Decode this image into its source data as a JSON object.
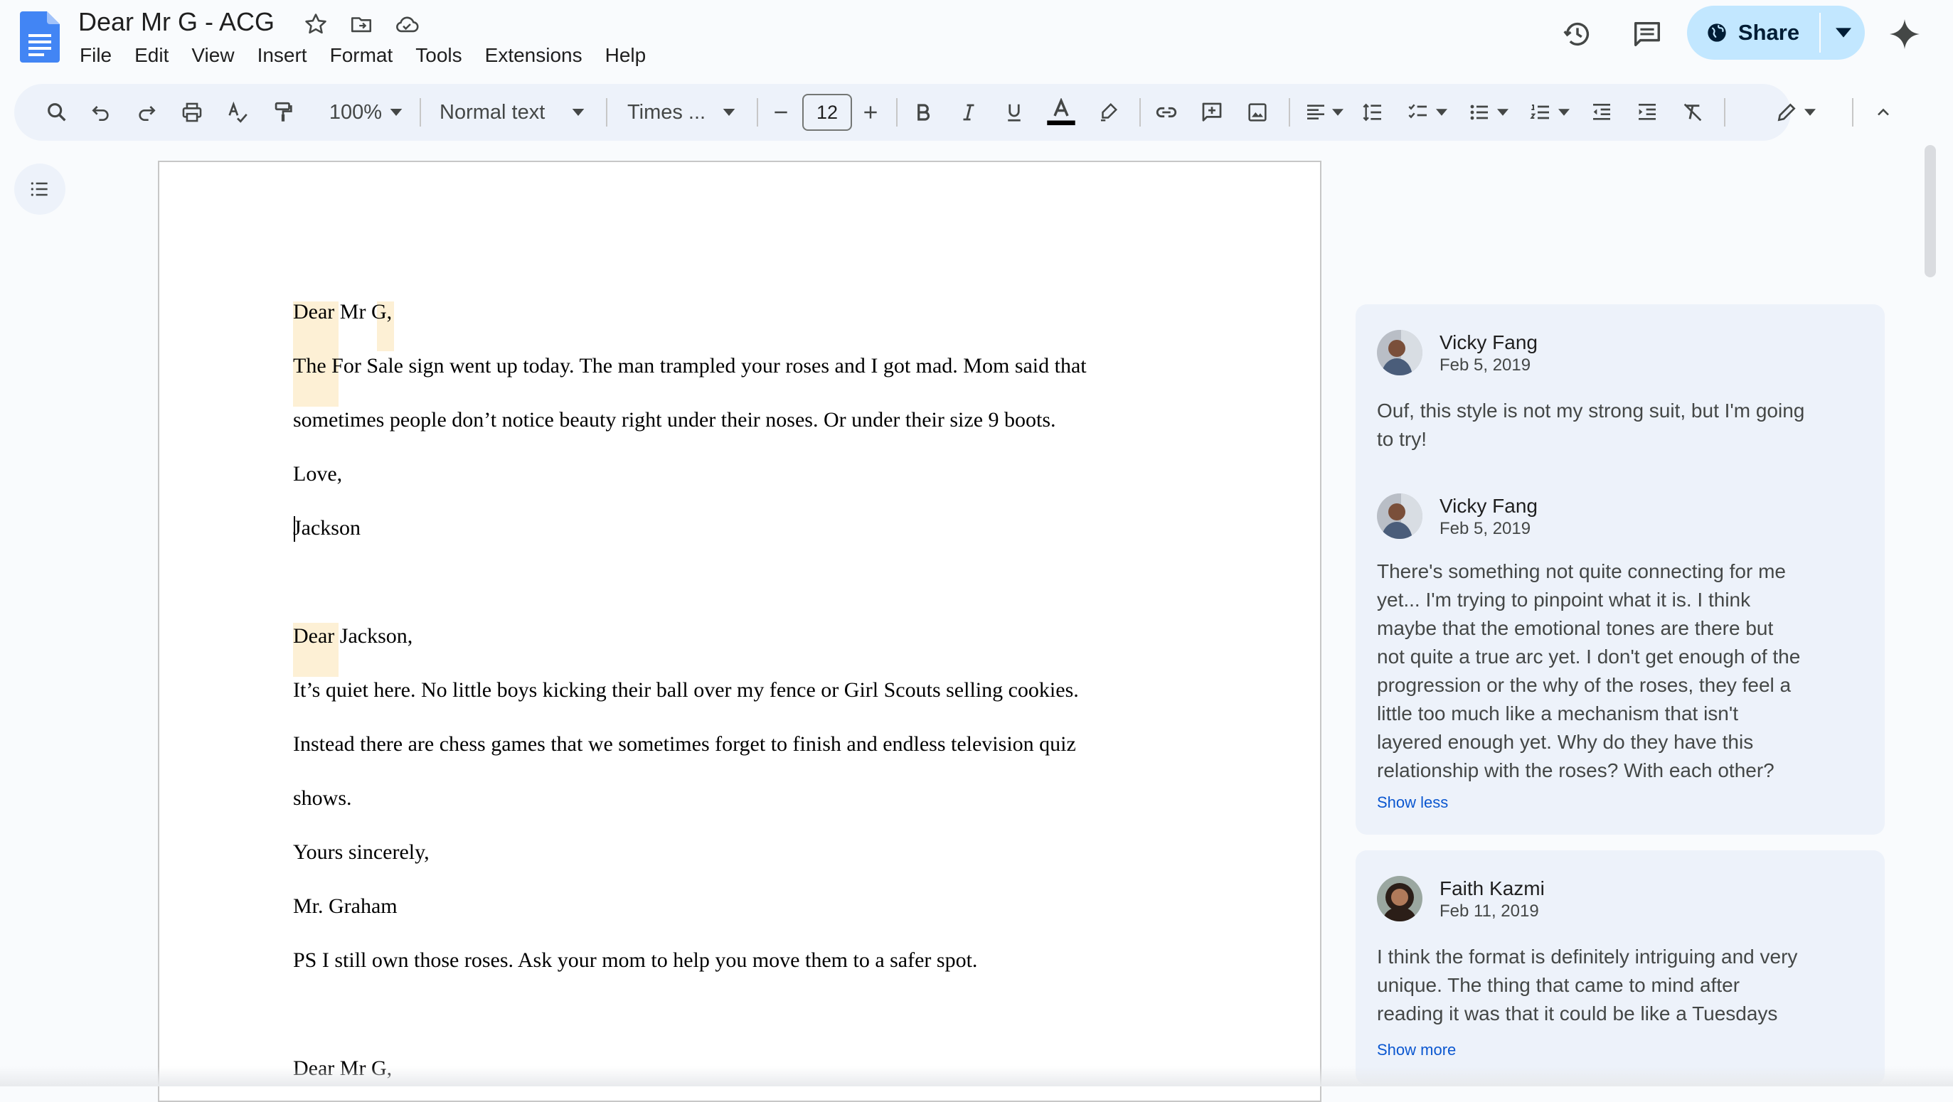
{
  "app": {
    "doc_title": "Dear Mr G - ACG",
    "menu": [
      "File",
      "Edit",
      "View",
      "Insert",
      "Format",
      "Tools",
      "Extensions",
      "Help"
    ],
    "share_label": "Share"
  },
  "toolbar": {
    "zoom": "100%",
    "style": "Normal text",
    "font": "Times ...",
    "font_size": "12"
  },
  "document": {
    "lines": [
      "Dear Mr G,",
      "The For Sale sign went up today. The man trampled your roses and I got mad. Mom said that",
      "sometimes people don’t notice beauty right under their noses. Or under their size 9 boots.",
      "Love,",
      "Jackson",
      "Dear Jackson,",
      "It’s quiet here. No little boys kicking their ball over my fence or Girl Scouts selling cookies.",
      "Instead there are chess games that we sometimes forget to finish and endless television quiz",
      "shows.",
      "Yours sincerely,",
      "Mr. Graham",
      "PS I still own those roses. Ask your mom to help you move them to a safer spot.",
      "Dear Mr G,"
    ]
  },
  "comments": [
    {
      "author": "Vicky Fang",
      "date": "Feb 5, 2019",
      "text": [
        "Ouf, this style is not my strong suit, but I'm going",
        "to try!"
      ]
    },
    {
      "author": "Vicky Fang",
      "date": "Feb 5, 2019",
      "text": [
        "There's something not quite connecting for me",
        "yet... I'm trying to pinpoint what it is. I think",
        "maybe that the emotional tones are there but",
        "not quite a true arc yet. I don't get enough of the",
        "progression or the why of the roses, they feel a",
        "little too much like a mechanism that isn't",
        "layered enough yet. Why do they have this",
        "relationship with the roses? With each other?"
      ],
      "link": "Show less"
    },
    {
      "author": "Faith Kazmi",
      "date": "Feb 11, 2019",
      "text": [
        "I think the format is definitely intriguing and very",
        "unique. The thing that came to mind after",
        "reading it was that it could be like a Tuesdays"
      ],
      "link": "Show more"
    }
  ],
  "colors": {
    "background": "#f9fbfd",
    "toolbar": "#edf2fa",
    "share_button": "#c2e7ff",
    "highlight": "#fdf0d5",
    "link": "#0b57d0"
  },
  "icons": {
    "title": [
      "star-icon",
      "move-to-folder-icon",
      "cloud-saved-icon"
    ],
    "top_right": [
      "version-history-icon",
      "comments-icon",
      "globe-icon",
      "gemini-icon"
    ],
    "toolbar": [
      "search-icon",
      "undo-icon",
      "redo-icon",
      "print-icon",
      "spellcheck-icon",
      "paint-format-icon",
      "bold-icon",
      "italic-icon",
      "underline-icon",
      "text-color-icon",
      "highlight-icon",
      "link-icon",
      "add-comment-icon",
      "insert-image-icon",
      "align-icon",
      "line-spacing-icon",
      "checklist-icon",
      "bulleted-list-icon",
      "numbered-list-icon",
      "decrease-indent-icon",
      "increase-indent-icon",
      "clear-formatting-icon",
      "editing-mode-icon",
      "collapse-menus-icon"
    ]
  }
}
